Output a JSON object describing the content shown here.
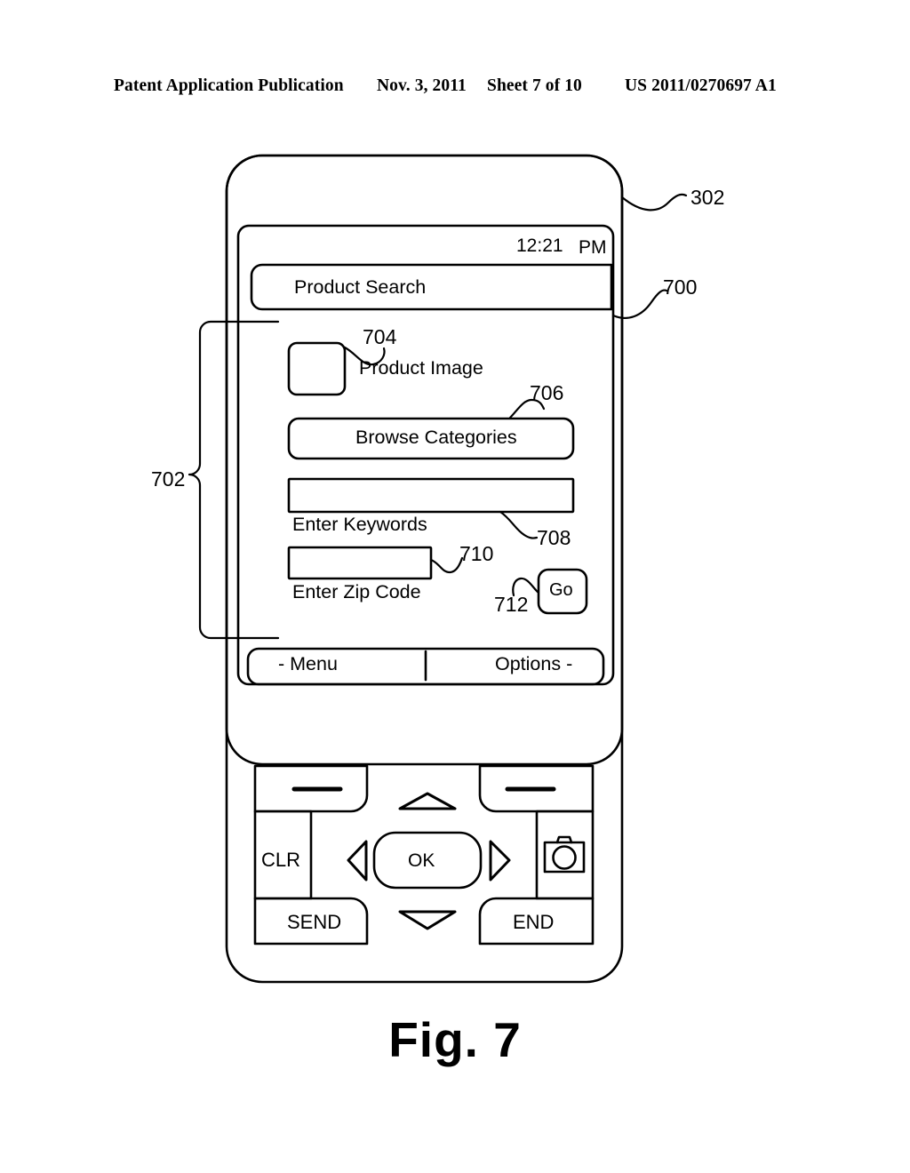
{
  "header": {
    "publication": "Patent Application Publication",
    "date": "Nov. 3, 2011",
    "sheet": "Sheet 7 of 10",
    "patent_number": "US 2011/0270697 A1"
  },
  "figure": {
    "caption": "Fig. 7",
    "reference_numerals": {
      "device_body": "302",
      "screen_ui": "700",
      "content_area": "702",
      "product_image": "704",
      "browse_categories": "706",
      "enter_keywords": "708",
      "enter_zip_code": "710",
      "go_button": "712"
    }
  },
  "phone": {
    "screen": {
      "status_bar": {
        "time": "12:21",
        "ampm": "PM"
      },
      "title_bar": {
        "title": "Product Search"
      },
      "content": {
        "product_image_label": "Product Image",
        "browse_categories_label": "Browse Categories",
        "keywords_field": {
          "value": "",
          "label": "Enter Keywords"
        },
        "zip_field": {
          "value": "",
          "label": "Enter Zip Code"
        },
        "go_button_label": "Go"
      },
      "soft_key_bar": {
        "left_label": "- Menu",
        "right_label": "Options -"
      }
    },
    "keypad": {
      "left_soft_key": "",
      "right_soft_key": "",
      "clear_key": "CLR",
      "send_key": "SEND",
      "end_key": "END",
      "ok_key": "OK",
      "up_key": "nav-up-icon",
      "down_key": "nav-down-icon",
      "left_key": "nav-left-icon",
      "right_key": "nav-right-icon",
      "camera_key": "camera-icon"
    }
  },
  "colors": {
    "ink": "#000000",
    "paper": "#ffffff"
  }
}
